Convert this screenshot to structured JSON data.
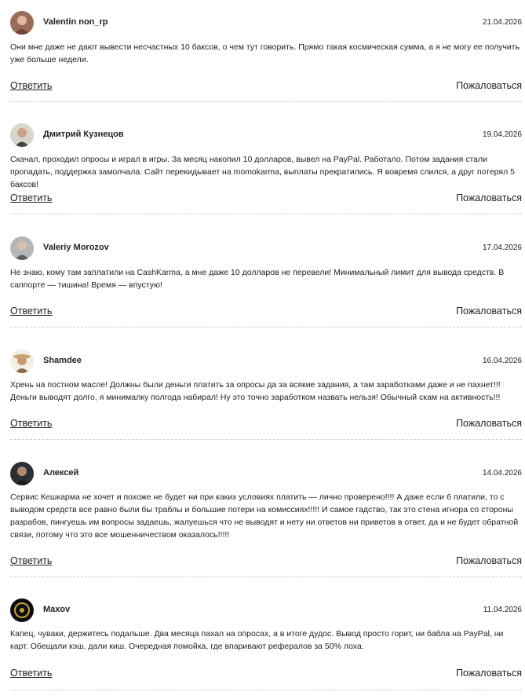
{
  "comments": [
    {
      "author": "Valentin non_rp",
      "date": "21.04.2026",
      "text": "Они мне даже не дают вывести несчастных 10 баксов, о чем тут говорить. Прямо такая космическая сумма, а я не могу ее получить уже больше недели.",
      "reply_label": "Ответить",
      "report_label": "Пожаловаться",
      "avatar_icon": "user-photo-icon"
    },
    {
      "author": "Дмитрий Кузнецов",
      "date": "19.04.2026",
      "text": "Скачал, проходил опросы и играл в игры. За месяц накопил 10 долларов, вывел на PayPal. Работало. Потом задания стали пропадать, поддержка замолчала. Сайт перекидывает на momokarma, выплаты прекратились. Я вовремя слился, а друг потерял 5 баксов!",
      "reply_label": "Ответить",
      "report_label": "Пожаловаться",
      "avatar_icon": "user-photo-icon"
    },
    {
      "author": "Valeriy Morozov",
      "date": "17.04.2026",
      "text": "Не знаю, кому там заплатили на CashKarma, а мне даже 10 долларов не перевели! Минимальный лимит для вывода средств. В саппорте — тишина! Время — впустую!",
      "reply_label": "Ответить",
      "report_label": "Пожаловаться",
      "avatar_icon": "user-photo-icon"
    },
    {
      "author": "Shamdee",
      "date": "16.04.2026",
      "text": "Хрень на постном масле! Должны были деньги платить за опросы да за всякие задания, а там заработками даже и не пахнет!!! Деньги выводят долго, я минималку полгода набирал! Ну это точно заработком назвать нельзя! Обычный скам на активность!!!",
      "reply_label": "Ответить",
      "report_label": "Пожаловаться",
      "avatar_icon": "user-photo-icon"
    },
    {
      "author": "Алексей",
      "date": "14.04.2026",
      "text": "Сервис Кешкарма не хочет и похоже не будет ни при каких условиях платить — лично проверено!!!! А даже если б платили, то с выводом средств все равно были бы траблы и большие потери на комиссиях!!!!! И самое гадство, так это стена игнора со стороны разрабов, пингуешь им вопросы задаешь, жалуешься что не выводят и нету ни ответов ни приветов в ответ, да и не будет обратной связи, потому что это все мошенничеством оказалось!!!!!",
      "reply_label": "Ответить",
      "report_label": "Пожаловаться",
      "avatar_icon": "user-photo-icon"
    },
    {
      "author": "Maxov",
      "date": "11.04.2026",
      "text": "Капец, чуваки, держитесь подальше. Два месяца пахал на опросах, а в итоге дудос. Вывод просто горит, ни бабла на PayPal, ни карт. Обещали кэш, дали киш. Очередная помойка, где впаривают рефералов за 50% лоха.",
      "reply_label": "Ответить",
      "report_label": "Пожаловаться",
      "avatar_icon": "user-photo-icon"
    }
  ],
  "colors": {
    "text": "#222222",
    "separator": "#cfcfcf"
  }
}
